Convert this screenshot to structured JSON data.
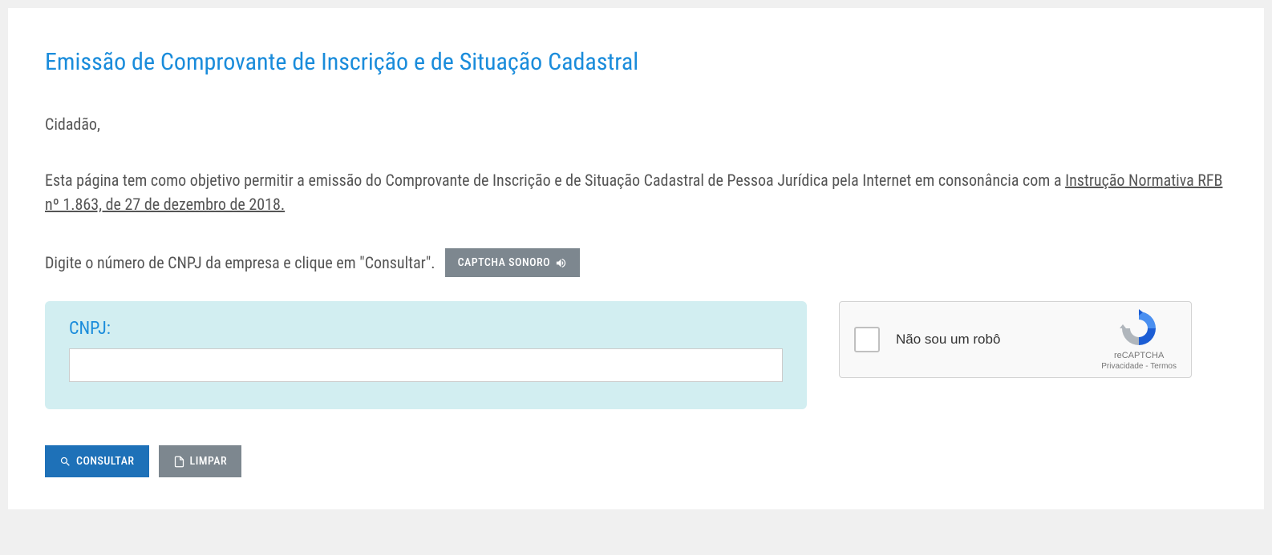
{
  "page_title": "Emissão de Comprovante de Inscrição e de Situação Cadastral",
  "greeting": "Cidadão,",
  "intro_prefix": "Esta página tem como objetivo permitir a emissão do Comprovante de Inscrição e de Situação Cadastral de Pessoa Jurídica pela Internet em consonância com a ",
  "intro_link_text": "Instrução Normativa RFB nº 1.863, de 27 de dezembro de 2018.",
  "instruction_text": "Digite o número de CNPJ da empresa e clique em \"Consultar\".",
  "captcha_sonoro_label": "CAPTCHA SONORO",
  "form": {
    "cnpj_label": "CNPJ:",
    "cnpj_value": ""
  },
  "recaptcha": {
    "label": "Não sou um robô",
    "brand": "reCAPTCHA",
    "privacy": "Privacidade",
    "terms": "Termos"
  },
  "buttons": {
    "consultar": "CONSULTAR",
    "limpar": "LIMPAR"
  }
}
